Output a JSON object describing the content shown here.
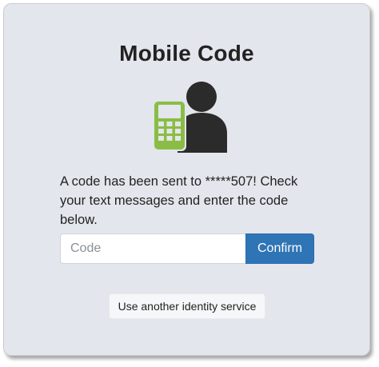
{
  "title": "Mobile Code",
  "hero_icon": "mobile-phone-with-person-icon",
  "message": "A code has been sent to *****507! Check your text messages and enter the code below.",
  "code_input": {
    "value": "",
    "placeholder": "Code"
  },
  "confirm_label": "Confirm",
  "alt_service_label": "Use another identity service",
  "colors": {
    "card_background": "#e3e6ec",
    "primary_button": "#2f74b5",
    "phone_icon": "#8bbd45",
    "person_icon": "#2b2b2b"
  }
}
